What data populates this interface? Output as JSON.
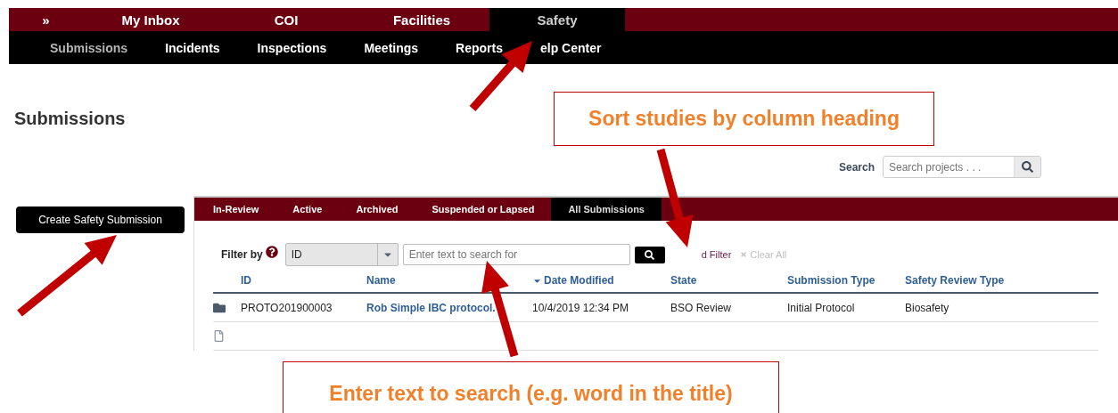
{
  "top_nav": {
    "expand_glyph": "»",
    "items": [
      {
        "label": "My Inbox",
        "selected": false
      },
      {
        "label": "COI",
        "selected": false
      },
      {
        "label": "Facilities",
        "selected": false
      },
      {
        "label": "Safety",
        "selected": true
      }
    ]
  },
  "sub_nav": [
    {
      "label": "Submissions",
      "selected": true
    },
    {
      "label": "Incidents",
      "selected": false
    },
    {
      "label": "Inspections",
      "selected": false
    },
    {
      "label": "Meetings",
      "selected": false
    },
    {
      "label": "Reports",
      "selected": false
    },
    {
      "label": "elp Center",
      "selected": false
    }
  ],
  "page_title": "Submissions",
  "search": {
    "label": "Search",
    "placeholder": "Search projects . . ."
  },
  "create_button": "Create Safety Submission",
  "tabs": [
    {
      "label": "In-Review",
      "selected": false
    },
    {
      "label": "Active",
      "selected": false
    },
    {
      "label": "Archived",
      "selected": false
    },
    {
      "label": "Suspended or Lapsed",
      "selected": false
    },
    {
      "label": "All Submissions",
      "selected": true
    }
  ],
  "filter": {
    "label": "Filter by",
    "field": "ID",
    "placeholder": "Enter text to search for",
    "add_filter": "d Filter",
    "clear_all": "Clear All"
  },
  "table": {
    "columns": [
      {
        "label": "ID",
        "sorted": false
      },
      {
        "label": "Name",
        "sorted": false
      },
      {
        "label": "Date Modified",
        "sorted": true
      },
      {
        "label": "State",
        "sorted": false
      },
      {
        "label": "Submission Type",
        "sorted": false
      },
      {
        "label": "Safety Review Type",
        "sorted": false
      }
    ],
    "rows": [
      {
        "kind": "folder",
        "cells": [
          "PROTO201900003",
          "Rob Simple IBC protocol.",
          "10/4/2019 12:34 PM",
          "BSO Review",
          "Initial Protocol",
          "Biosafety"
        ]
      },
      {
        "kind": "document"
      }
    ]
  },
  "callouts": [
    {
      "text": "Sort studies by column heading"
    },
    {
      "text": "Enter text to search (e.g. word in the title)"
    }
  ]
}
